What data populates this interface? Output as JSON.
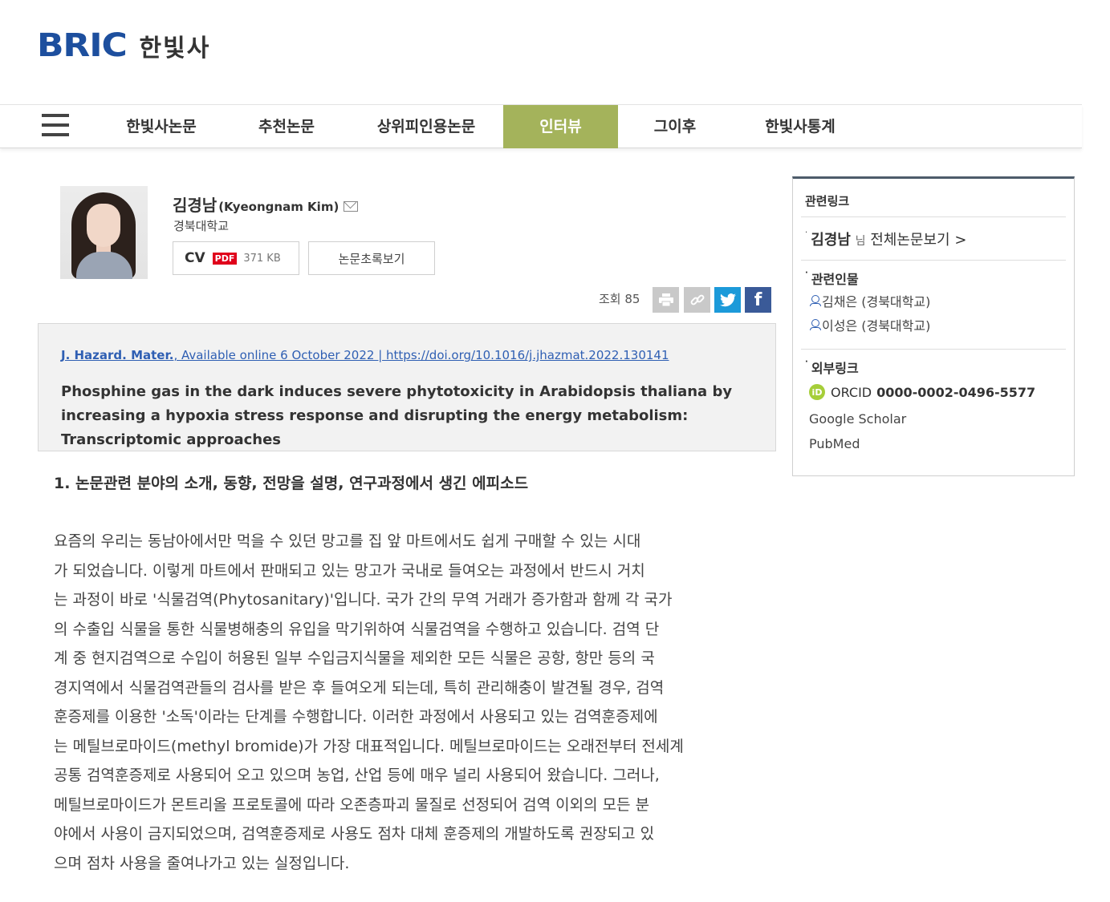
{
  "header": {
    "logo_bric": "BRIC",
    "logo_ko": "한빛사"
  },
  "nav": {
    "items": [
      {
        "label": "한빛사논문"
      },
      {
        "label": "추천논문"
      },
      {
        "label": "상위피인용논문"
      },
      {
        "label": "인터뷰",
        "active": true
      },
      {
        "label": "그이후"
      },
      {
        "label": "한빛사통계"
      }
    ],
    "active_color": "#a4b35b"
  },
  "profile": {
    "name_ko": "김경남",
    "name_en": "(Kyeongnam Kim)",
    "affiliation": "경북대학교",
    "cv_label": "CV",
    "pdf_badge": "PDF",
    "cv_size": "371 KB",
    "abstract_button": "논문초록보기",
    "views_label": "조회 85"
  },
  "share": {
    "facebook_glyph": "f"
  },
  "citation": {
    "journal": "J. Hazard. Mater.",
    "meta": ", Available online 6 October 2022 | https://doi.org/10.1016/j.jhazmat.2022.130141",
    "title": "Phosphine gas in the dark induces severe phytotoxicity in Arabidopsis thaliana by increasing a hypoxia stress response and disrupting the energy metabolism: Transcriptomic approaches"
  },
  "content": {
    "question": "1. 논문관련 분야의 소개, 동향, 전망을 설명, 연구과정에서 생긴 에피소드",
    "lines": [
      "요즘의 우리는 동남아에서만 먹을 수 있던 망고를 집 앞 마트에서도 쉽게 구매할 수 있는 시대",
      "가 되었습니다. 이렇게 마트에서 판매되고 있는 망고가 국내로 들여오는 과정에서 반드시 거치",
      "는 과정이 바로 '식물검역(Phytosanitary)'입니다. 국가 간의 무역 거래가 증가함과 함께 각 국가",
      "의 수출입 식물을 통한 식물병해충의 유입을 막기위하여 식물검역을 수행하고 있습니다. 검역 단",
      "계 중 현지검역으로 수입이 허용된 일부 수입금지식물을 제외한 모든 식물은 공항, 항만 등의 국",
      "경지역에서 식물검역관들의 검사를 받은 후 들여오게 되는데, 특히 관리해충이 발견될 경우, 검역",
      "훈증제를 이용한 '소독'이라는 단계를 수행합니다. 이러한 과정에서 사용되고 있는 검역훈증제에",
      "는 메틸브로마이드(methyl bromide)가 가장 대표적입니다. 메틸브로마이드는 오래전부터 전세계",
      "공통 검역훈증제로 사용되어 오고 있으며 농업, 산업 등에 매우 널리 사용되어 왔습니다. 그러나,",
      "메틸브로마이드가 몬트리올 프로토콜에 따라 오존층파괴 물질로 선정되어 검역 이외의 모든 분",
      "야에서 사용이 금지되었으며, 검역훈증제로 사용도 점차 대체 훈증제의 개발하도록 권장되고 있",
      "으며 점차 사용을 줄여나가고 있는 실정입니다."
    ]
  },
  "sidebar": {
    "title": "관련링크",
    "all_papers_name": "김경남",
    "all_papers_nim": "님",
    "all_papers_label": "전체논문보기 >",
    "related_title": "관련인물",
    "related": [
      "김채은 (경북대학교)",
      "이성은 (경북대학교)"
    ],
    "external_title": "외부링크",
    "orcid_label": "ORCID",
    "orcid_id": "0000-0002-0496-5577",
    "links": [
      "Google Scholar",
      "PubMed"
    ]
  }
}
